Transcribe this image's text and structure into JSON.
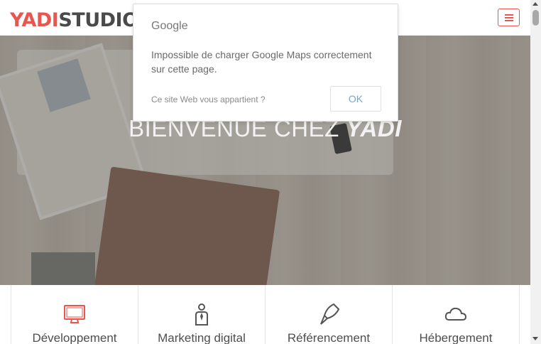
{
  "header": {
    "logo_part1": "YADI",
    "logo_part2": "STUDIO"
  },
  "hero": {
    "title_prefix": "BIENVENUE CHEZ ",
    "title_emphasis": "YADI"
  },
  "services": [
    {
      "label": "Développement",
      "icon": "monitor-icon"
    },
    {
      "label": "Marketing digital",
      "icon": "businessman-icon"
    },
    {
      "label": "Référencement",
      "icon": "rocket-icon"
    },
    {
      "label": "Hébergement",
      "icon": "cloud-icon"
    }
  ],
  "dialog": {
    "brand": "Google",
    "message": "Impossible de charger Google Maps correctement sur cette page.",
    "owner_link": "Ce site Web vous appartient ?",
    "ok_label": "OK"
  },
  "colors": {
    "accent": "#e8564f",
    "text_dark": "#4a4a4a",
    "link_blue": "#6aa8d8"
  }
}
